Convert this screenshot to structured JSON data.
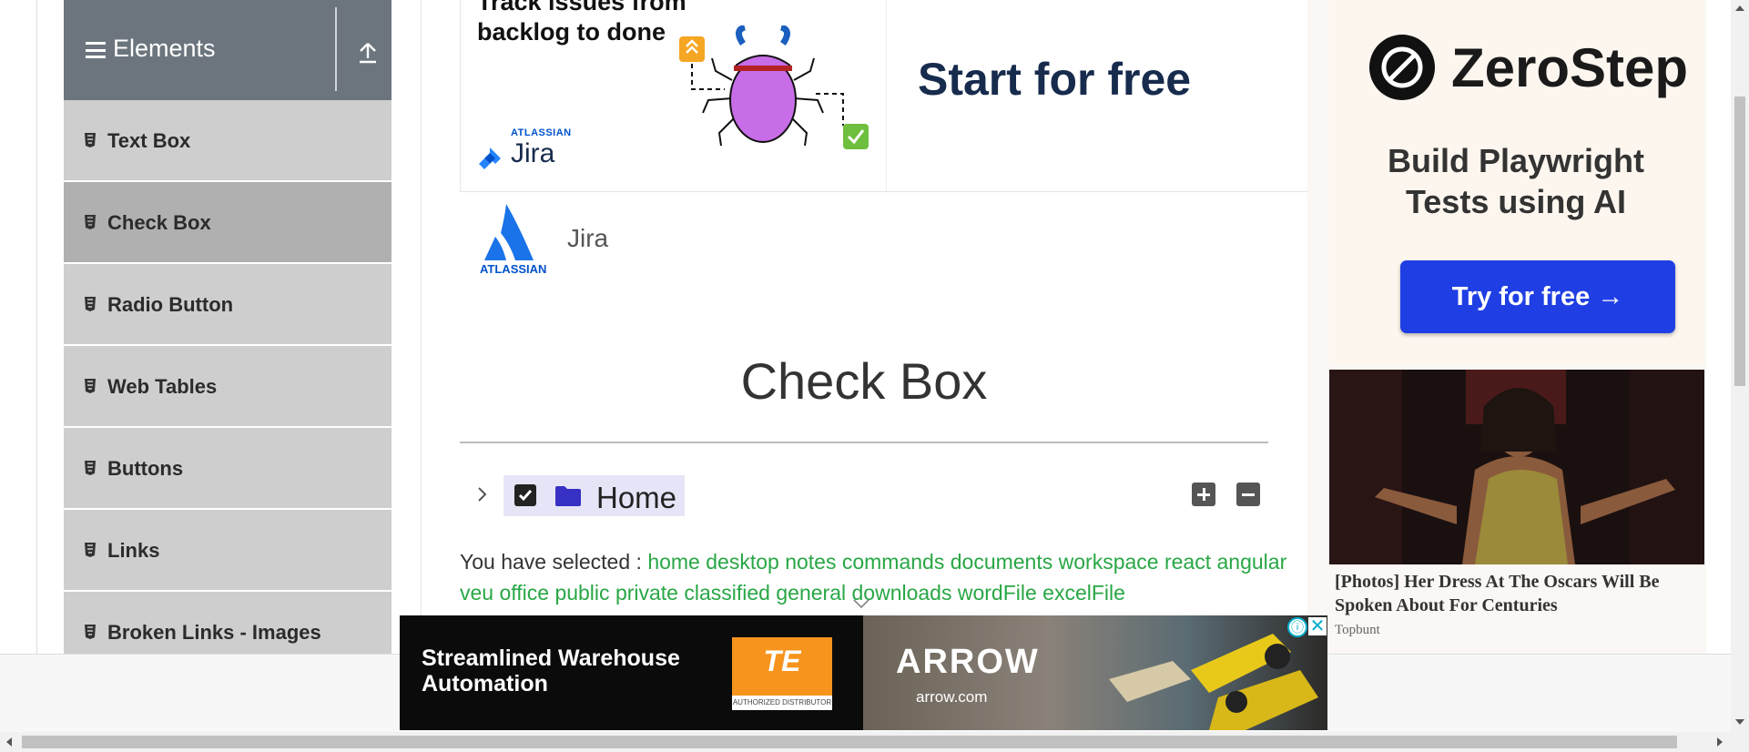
{
  "sidebar": {
    "group_title": "Elements",
    "items": [
      {
        "label": "Text Box"
      },
      {
        "label": "Check Box"
      },
      {
        "label": "Radio Button"
      },
      {
        "label": "Web Tables"
      },
      {
        "label": "Buttons"
      },
      {
        "label": "Links"
      },
      {
        "label": "Broken Links - Images"
      }
    ],
    "active_item": "Check Box"
  },
  "top_ad": {
    "headline": "Track issues from backlog to done",
    "brand_small": "ATLASSIAN",
    "brand_name": "Jira",
    "cta": "Start for free"
  },
  "sponsor": {
    "brand": "ATLASSIAN",
    "name": "Jira"
  },
  "page": {
    "title": "Check Box"
  },
  "tree": {
    "root_label": "Home",
    "checked": true,
    "expand_all_icon": "plus-square-icon",
    "collapse_all_icon": "minus-square-icon"
  },
  "result": {
    "prefix": "You have selected :",
    "items": [
      "home",
      "desktop",
      "notes",
      "commands",
      "documents",
      "workspace",
      "react",
      "angular",
      "veu",
      "office",
      "public",
      "private",
      "classified",
      "general",
      "downloads",
      "wordFile",
      "excelFile"
    ]
  },
  "right_ad": {
    "brand": "ZeroStep",
    "tagline": "Build Playwright Tests using AI",
    "cta": "Try for free →",
    "article_title": "[Photos] Her Dress At The Oscars Will Be Spoken About For Centuries",
    "article_source": "Topbunt"
  },
  "bottom_ad": {
    "text": "Streamlined Warehouse Automation",
    "te_logo": "TE",
    "te_tagline": "AUTHORIZED DISTRIBUTOR",
    "arrow_logo": "ARROW",
    "arrow_url": "arrow.com",
    "info_icon": "ⓘ",
    "close_icon": "✕"
  },
  "colors": {
    "sidebar_header": "#6c757d",
    "sidebar_item": "#cecece",
    "sidebar_active": "#b0b0b0",
    "selected_text": "#28a745",
    "tree_highlight": "#e6e5f7",
    "zerostep_cta": "#1f3fe4"
  }
}
